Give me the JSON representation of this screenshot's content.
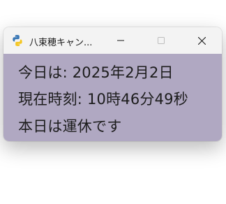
{
  "window": {
    "title": "八束穂キャン...",
    "background_color": "#b0a8c2",
    "titlebar_color": "#f3f3f3"
  },
  "controls": {
    "minimize_icon": "minimize-icon",
    "maximize_icon": "maximize-icon",
    "close_icon": "close-icon"
  },
  "content": {
    "date_line": "今日は:  2025年2月2日",
    "time_line": "現在時刻:  10時46分49秒",
    "status_line": "本日は運休です"
  }
}
